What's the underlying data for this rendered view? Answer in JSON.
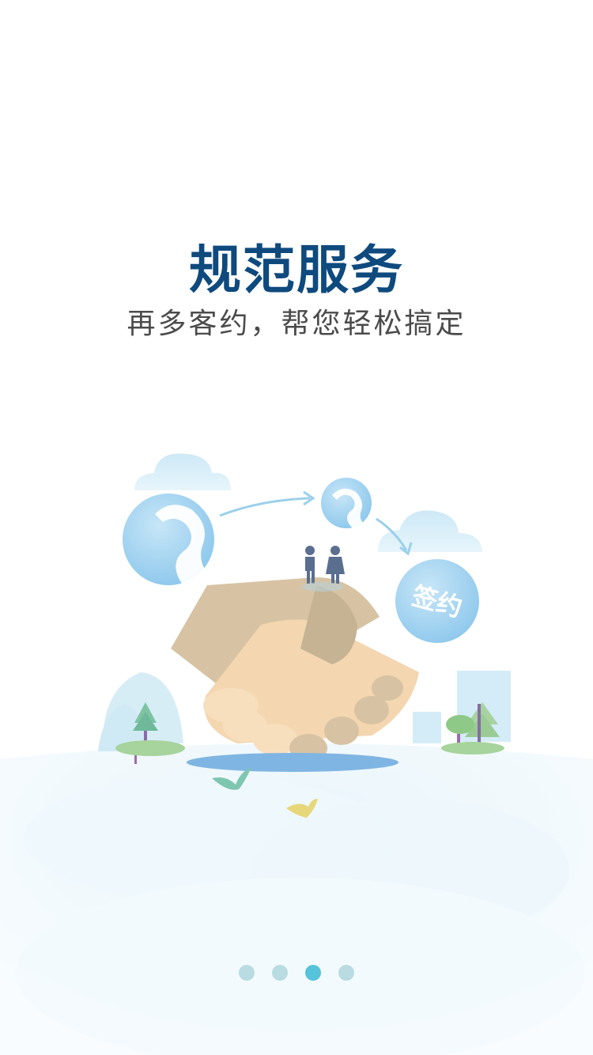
{
  "headline": {
    "title": "规范服务",
    "subtitle": "再多客约，帮您轻松搞定"
  },
  "illustration": {
    "badge_text": "签约",
    "icons": [
      "cloud-icon",
      "person-silhouette-icon",
      "handshake-icon",
      "couple-icon",
      "tree-icon",
      "bird-icon"
    ]
  },
  "pager": {
    "total": 4,
    "active_index": 3
  },
  "colors": {
    "title": "#0f4a7e",
    "subtitle": "#4b4b4b",
    "dot_inactive": "#b9dbe2",
    "dot_active": "#55c3d9"
  }
}
